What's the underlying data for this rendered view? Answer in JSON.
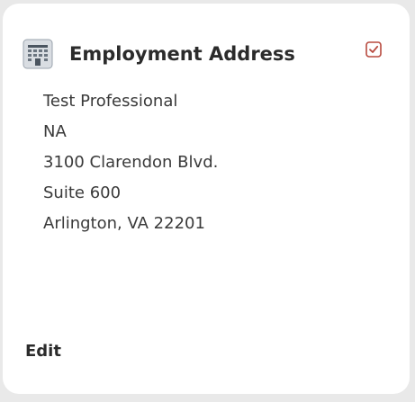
{
  "card": {
    "title": "Employment Address",
    "icon": "building-icon",
    "status_icon": "checkbox-checked-icon",
    "accent_color": "#b84a3f",
    "address_lines": [
      "Test Professional",
      "NA",
      "3100 Clarendon Blvd.",
      "Suite 600",
      "Arlington, VA 22201"
    ],
    "edit_label": "Edit"
  }
}
